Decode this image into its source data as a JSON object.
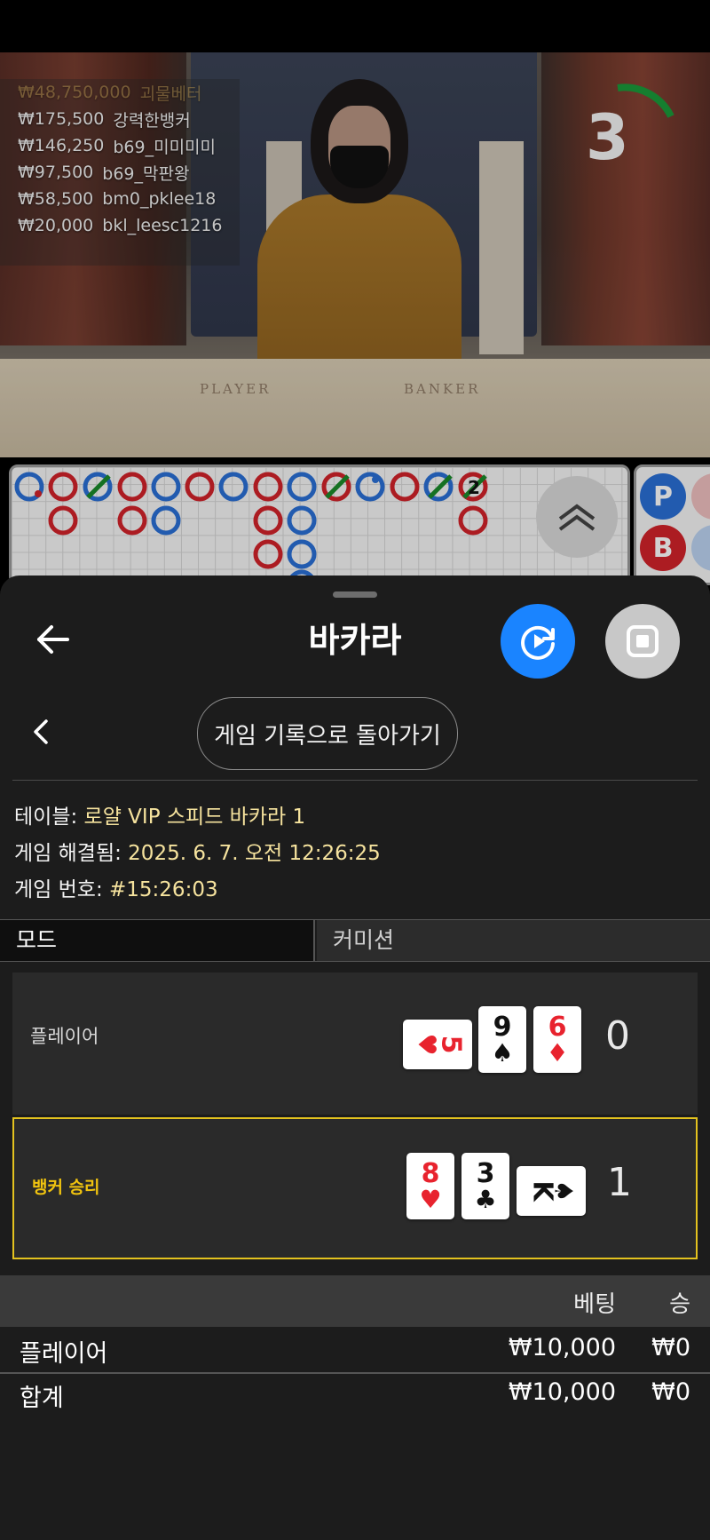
{
  "video": {
    "leaderboard": [
      {
        "amount": "₩48,750,000",
        "name": "괴물베터"
      },
      {
        "amount": "₩175,500",
        "name": "강력한뱅커"
      },
      {
        "amount": "₩146,250",
        "name": "b69_미미미미"
      },
      {
        "amount": "₩97,500",
        "name": "b69_막판왕"
      },
      {
        "amount": "₩58,500",
        "name": "bm0_pklee18"
      },
      {
        "amount": "₩20,000",
        "name": "bkl_leesc1216"
      }
    ],
    "countdown": "3",
    "table_felt": {
      "player": "PLAYER",
      "banker": "BANKER"
    },
    "colors": {
      "timer_arc": "#1a9a3a"
    }
  },
  "roadmap": {
    "pill_labels": [
      "P",
      "B"
    ],
    "marker_2": "2",
    "colors": {
      "banker": "#d2232a",
      "player": "#2a6fd6",
      "tie": "#1a8a2a"
    }
  },
  "sheet": {
    "title": "바카라",
    "history_button": "게임 기록으로 돌아가기",
    "info": {
      "table_label": "테이블: ",
      "table_value": "로얄 VIP 스피드 바카라 1",
      "resolved_label": "게임 해결됨: ",
      "resolved_value": "2025. 6. 7. 오전 12:26:25",
      "number_label": "게임 번호: ",
      "number_value": "#15:26:03"
    },
    "tabs": {
      "mode": "모드",
      "commission": "커미션"
    },
    "hands": {
      "player": {
        "label": "플레이어",
        "score": "0",
        "cards": [
          {
            "rank": "5",
            "suit": "♥",
            "color": "red",
            "sideways": true
          },
          {
            "rank": "9",
            "suit": "♠",
            "color": "black",
            "sideways": false
          },
          {
            "rank": "6",
            "suit": "♦",
            "color": "red",
            "sideways": false
          }
        ]
      },
      "banker": {
        "label": "뱅커 승리",
        "score": "1",
        "cards": [
          {
            "rank": "8",
            "suit": "♥",
            "color": "red",
            "sideways": false
          },
          {
            "rank": "3",
            "suit": "♣",
            "color": "black",
            "sideways": false
          },
          {
            "rank": "K",
            "suit": "♠",
            "color": "black",
            "sideways": true
          }
        ]
      }
    },
    "bets": {
      "header": {
        "bet": "베팅",
        "win": "승"
      },
      "rows": [
        {
          "label": "플레이어",
          "bet": "₩10,000",
          "win": "₩0"
        }
      ],
      "total": {
        "label": "합계",
        "bet": "₩10,000",
        "win": "₩0"
      }
    },
    "colors": {
      "accent": "#f6e39e",
      "winner_border": "#e3c21f",
      "record_button": "#1a84ff"
    }
  }
}
